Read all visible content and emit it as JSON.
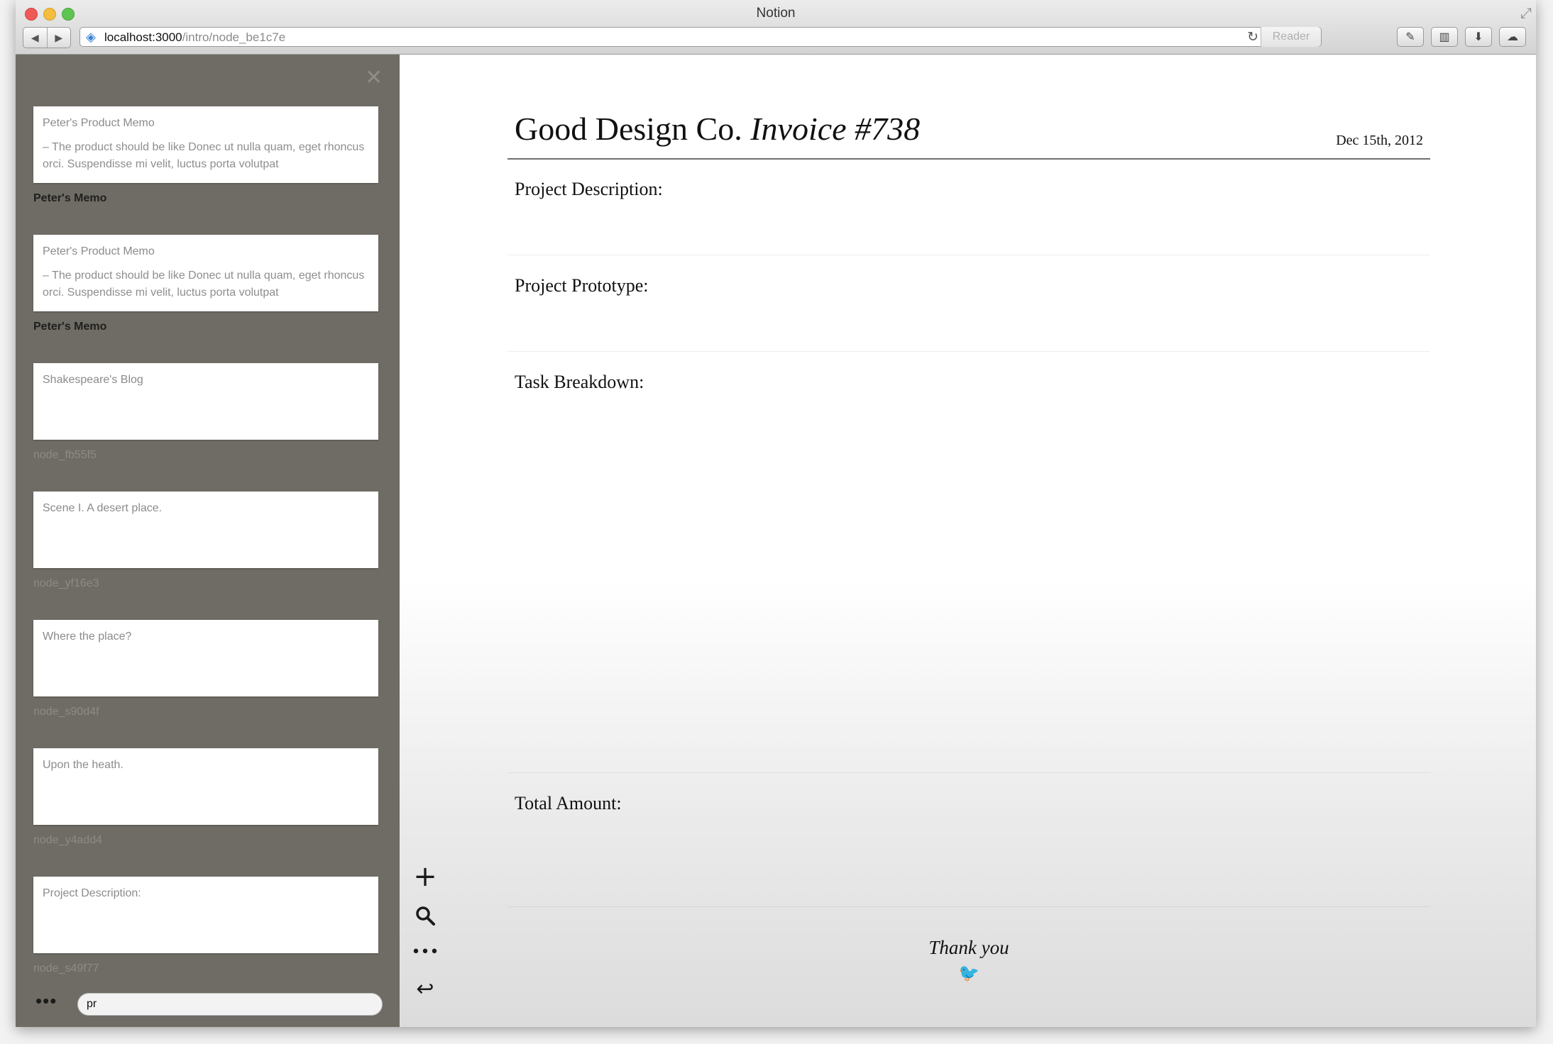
{
  "window": {
    "title": "Notion",
    "url_host": "localhost:3000",
    "url_path": "/intro/node_be1c7e",
    "reader_label": "Reader"
  },
  "sidebar": {
    "nodes": [
      {
        "title": "Peter's Product Memo",
        "body": "– The product should be like Donec ut nulla quam, eget rhoncus orci. Suspendisse mi velit, luctus porta volutpat",
        "label": "Peter's Memo"
      },
      {
        "title": "Peter's Product Memo",
        "body": "– The product should be like Donec ut nulla quam, eget rhoncus orci. Suspendisse mi velit, luctus porta volutpat",
        "label": "Peter's Memo"
      },
      {
        "title": "Shakespeare's Blog",
        "body": "",
        "label": "node_fb55f5"
      },
      {
        "title": "Scene I. A desert place.",
        "body": "",
        "label": "node_yf16e3"
      },
      {
        "title": "Where the place?",
        "body": "",
        "label": "node_s90d4f"
      },
      {
        "title": "Upon the heath.",
        "body": "",
        "label": "node_y4add4"
      },
      {
        "title": "Project Description:",
        "body": "",
        "label": "node_s49f77"
      }
    ],
    "search_value": "pr"
  },
  "document": {
    "company": "Good Design Co.",
    "invoice": "Invoice #738",
    "date": "Dec 15th, 2012",
    "sections": {
      "description": "Project Description:",
      "prototype": "Project Prototype:",
      "tasks": "Task Breakdown:",
      "total": "Total Amount:"
    },
    "closing": "Thank you"
  },
  "icons": {
    "add": "plus-icon",
    "search": "search-icon",
    "more": "more-icon",
    "back": "reply-icon",
    "close": "close-icon"
  }
}
